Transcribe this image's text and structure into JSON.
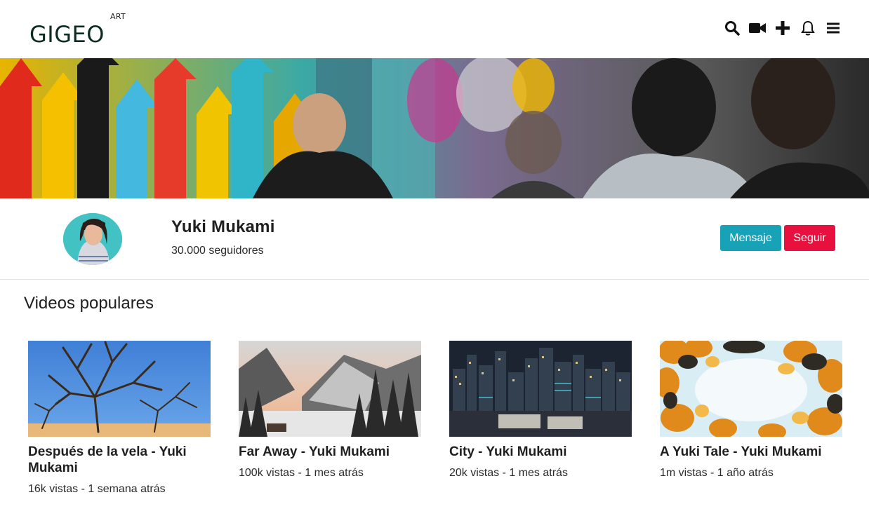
{
  "header": {
    "logo_main": "GIGEO",
    "logo_sup": "ART"
  },
  "icons": [
    "search-icon",
    "video-camera-icon",
    "plus-icon",
    "bell-icon",
    "menu-icon"
  ],
  "profile": {
    "name": "Yuki Mukami",
    "followers": "30.000 seguidores",
    "message_label": "Mensaje",
    "follow_label": "Seguir"
  },
  "colors": {
    "message_button": "#17a2b8",
    "follow_button": "#e8103e",
    "text": "#1f1f1f"
  },
  "section": {
    "title": "Videos populares"
  },
  "videos": [
    {
      "title": "Después de la vela - Yuki Mukami",
      "meta": "16k vistas - 1 semana atrás"
    },
    {
      "title": "Far Away - Yuki Mukami",
      "meta": "100k vistas - 1 mes atrás"
    },
    {
      "title": "City - Yuki Mukami",
      "meta": "20k vistas - 1 mes atrás"
    },
    {
      "title": "A Yuki Tale - Yuki Mukami",
      "meta": "1m vistas - 1 año atrás"
    }
  ]
}
